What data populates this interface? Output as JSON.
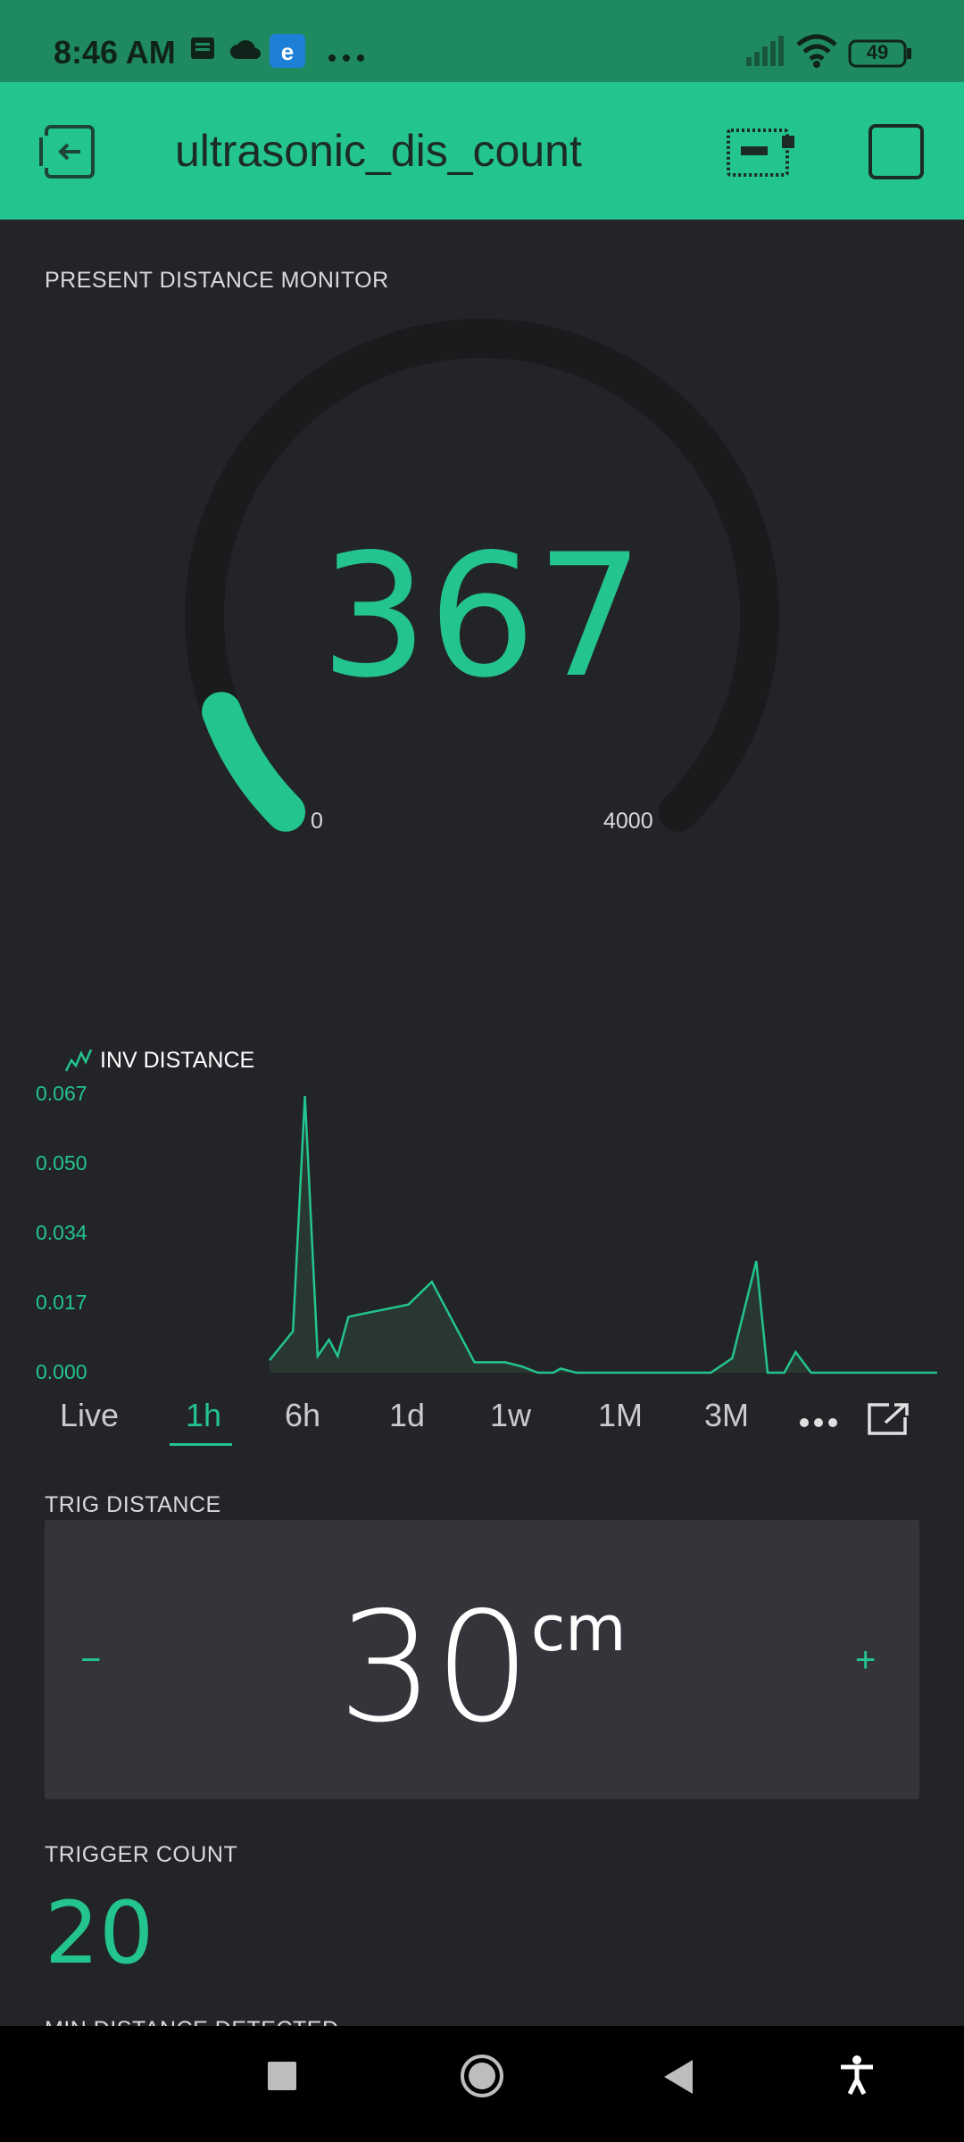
{
  "status_bar": {
    "time": "8:46 AM",
    "icons": [
      "notes-icon",
      "cloud-icon",
      "edge-icon",
      "more-dots-icon",
      "signal-icon",
      "wifi-icon"
    ],
    "battery": "49"
  },
  "app_bar": {
    "title": "ultrasonic_dis_count",
    "icons": [
      "exit-icon",
      "device-icon",
      "stop-square-icon"
    ]
  },
  "gauge": {
    "label": "PRESENT DISTANCE MONITOR",
    "value": "367",
    "min": "0",
    "max": "4000",
    "fraction": 0.092,
    "accent": "#23c48e"
  },
  "chart": {
    "legend": "INV DISTANCE",
    "y_ticks": [
      "0.067",
      "0.050",
      "0.034",
      "0.017",
      "0.000"
    ],
    "time_ranges": [
      "Live",
      "1h",
      "6h",
      "1d",
      "1w",
      "1M",
      "3M"
    ],
    "selected_range": "1h"
  },
  "chart_data": {
    "type": "area",
    "title": "INV DISTANCE",
    "ylim": [
      0,
      0.067
    ],
    "xlim": [
      0,
      100
    ],
    "grid": false,
    "x": [
      0,
      3.5,
      5.3,
      7.2,
      8.9,
      10.2,
      11.8,
      13.2,
      20.8,
      24.3,
      30.7,
      35.3,
      37.8,
      40.2,
      42.5,
      43.6,
      45.9,
      54,
      66.1,
      69.3,
      72.9,
      74.6,
      77.1,
      78.8,
      81.1
    ],
    "y": [
      0.003,
      0.01,
      0.067,
      0.004,
      0.008,
      0.004,
      0.0135,
      0.014,
      0.0165,
      0.022,
      0.0025,
      0.0025,
      0.0015,
      0,
      0,
      0.001,
      0,
      0,
      0,
      0.0035,
      0.027,
      0,
      0,
      0.005,
      0
    ]
  },
  "trig_distance": {
    "label": "TRIG DISTANCE",
    "value": "30",
    "unit": "cm",
    "minus": "−",
    "plus": "+"
  },
  "trigger_count": {
    "label": "TRIGGER COUNT",
    "value": "20"
  },
  "next_widget": {
    "label": "MIN DISTANCE DETECTED"
  }
}
